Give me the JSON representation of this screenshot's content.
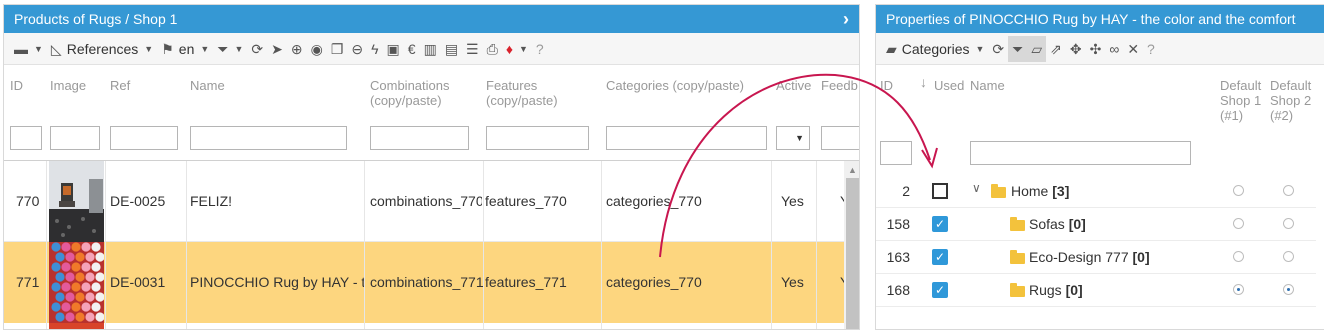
{
  "left": {
    "title": "Products of Rugs / Shop 1",
    "toolbar": {
      "references_label": "References",
      "language_label": "en",
      "icons": [
        "columns-icon",
        "hierarchy-icon",
        "flag-icon",
        "filter-icon",
        "refresh-icon",
        "pointer-icon",
        "add-icon",
        "add-image-icon",
        "copy-icon",
        "delete-icon",
        "lightning-icon",
        "add-stock-icon",
        "euro-icon",
        "barcode-icon",
        "csv-icon",
        "list-icon",
        "print-icon",
        "gem-icon",
        "help-icon"
      ]
    },
    "columns": {
      "id": "ID",
      "image": "Image",
      "ref": "Ref",
      "name": "Name",
      "combinations": "Combinations (copy/paste)",
      "features": "Features (copy/paste)",
      "categories": "Categories (copy/paste)",
      "active": "Active",
      "feedback": "Feedb"
    },
    "rows": [
      {
        "id": "770",
        "ref": "DE-0025",
        "name": "FELIZ!",
        "combinations": "combinations_770",
        "features": "features_770",
        "categories": "categories_770",
        "active": "Yes",
        "extra": "Y"
      },
      {
        "id": "771",
        "ref": "DE-0031",
        "name": "PINOCCHIO Rug by HAY - the color and the comfort",
        "combinations": "combinations_771",
        "features": "features_771",
        "categories": "categories_770",
        "active": "Yes",
        "extra": "Y"
      }
    ],
    "active_filter_caret": "▼"
  },
  "right": {
    "title": "Properties of PINOCCHIO Rug by HAY - the color and the comfort",
    "toolbar": {
      "categories_label": "Categories",
      "icons": [
        "folder-icon",
        "refresh-icon",
        "filter-icon",
        "open-folder-icon",
        "external-link-icon",
        "expand-icon",
        "collapse-icon",
        "link-icon",
        "unlink-icon",
        "help-icon"
      ]
    },
    "columns": {
      "id": "ID",
      "used": "Used",
      "name": "Name",
      "default_shop1": "Default Shop 1 (#1)",
      "default_shop2": "Default Shop 2 (#2)"
    },
    "rows": [
      {
        "id": "2",
        "used": false,
        "name": "Home",
        "count": "[3]",
        "shop1": false,
        "shop2": false
      },
      {
        "id": "158",
        "used": true,
        "name": "Sofas",
        "count": "[0]",
        "shop1": false,
        "shop2": false
      },
      {
        "id": "163",
        "used": true,
        "name": "Eco-Design 777",
        "count": "[0]",
        "shop1": false,
        "shop2": false
      },
      {
        "id": "168",
        "used": true,
        "name": "Rugs",
        "count": "[0]",
        "shop1": true,
        "shop2": true
      }
    ]
  },
  "colors": {
    "titlebar": "#3598d4",
    "selected_row": "#fdd67f",
    "checkbox_checked": "#2f98d9",
    "arrow": "#c8164f",
    "folder": "#f3c23c"
  }
}
